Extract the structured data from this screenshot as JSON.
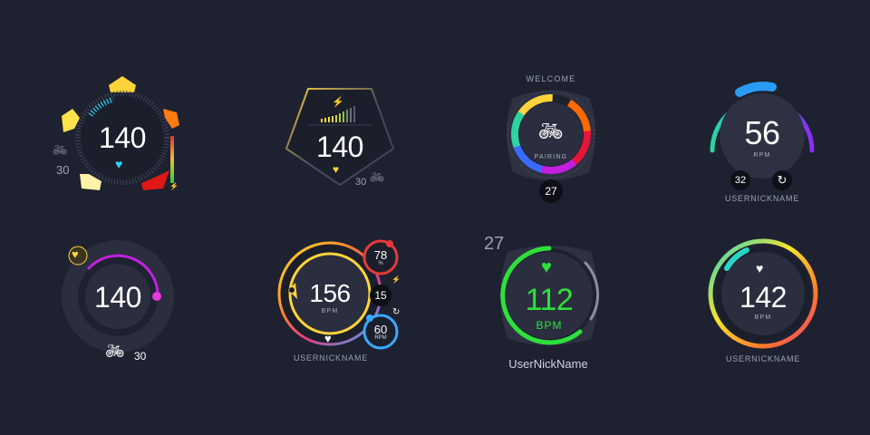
{
  "colors": {
    "background": "#1e2130",
    "face": "#2a2e3e",
    "accent_cyan": "#2bd5f5",
    "accent_yellow": "#ffd43b",
    "accent_magenta": "#c21fe0",
    "accent_green": "#2ee03c",
    "accent_red": "#e53a3a",
    "accent_blue": "#3aa8ff"
  },
  "widgets": {
    "w1": {
      "value": "140",
      "device_count": "30",
      "icons": [
        "heart-icon",
        "bike-icon",
        "bolt-icon"
      ]
    },
    "w2": {
      "value": "140",
      "device_count": "30",
      "icons": [
        "bolt-icon",
        "heart-icon",
        "bike-icon"
      ],
      "signal_level": 1.0
    },
    "w3": {
      "header": "WELCOME",
      "status": "PAIRING",
      "badge": "27",
      "icons": [
        "bike-icon"
      ]
    },
    "w4": {
      "value": "56",
      "unit": "RPM",
      "badge": "32",
      "username": "USERNICKNAME",
      "icons": [
        "refresh-icon"
      ]
    },
    "w5": {
      "value": "140",
      "device_count": "30",
      "icons": [
        "heart-icon",
        "bike-icon"
      ]
    },
    "w6": {
      "value": "156",
      "unit": "BPM",
      "username": "USERNICKNAME",
      "percent": "78",
      "percent_unit": "%",
      "power": "15",
      "cadence": "60",
      "cadence_unit": "RPM",
      "icons": [
        "heart-icon",
        "bolt-icon",
        "refresh-icon"
      ]
    },
    "w7": {
      "corner_number": "27",
      "value": "112",
      "unit": "BPM",
      "username": "UserNickName",
      "icons": [
        "heart-icon"
      ]
    },
    "w8": {
      "value": "142",
      "unit": "BPM",
      "username": "USERNICKNAME",
      "icons": [
        "heart-icon"
      ]
    }
  }
}
